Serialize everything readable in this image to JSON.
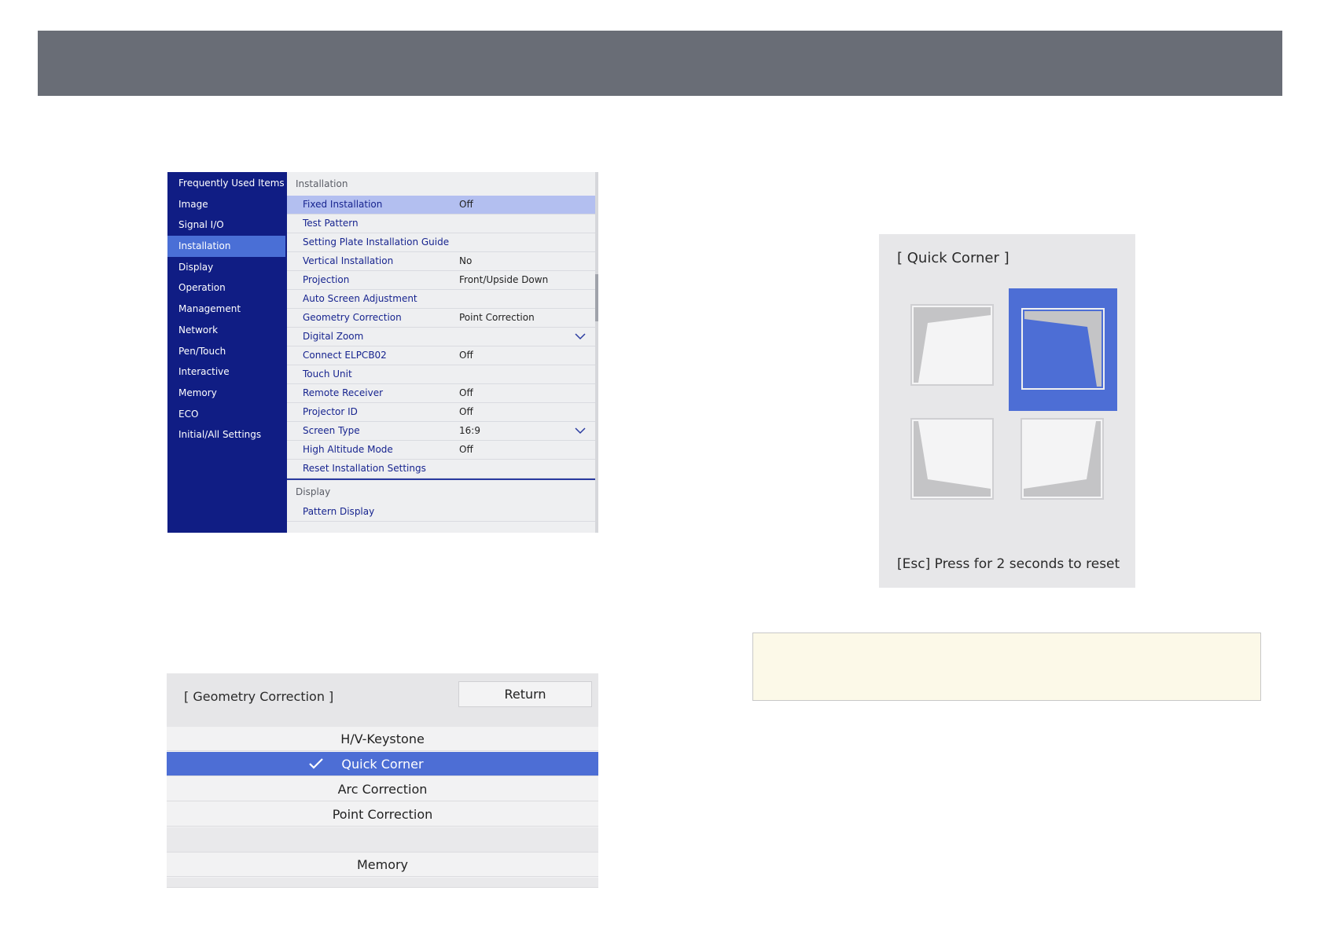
{
  "menu": {
    "sidebar": [
      {
        "label": "Frequently Used Items"
      },
      {
        "label": "Image"
      },
      {
        "label": "Signal I/O"
      },
      {
        "label": "Installation",
        "selected": true
      },
      {
        "label": "Display"
      },
      {
        "label": "Operation"
      },
      {
        "label": "Management"
      },
      {
        "label": "Network"
      },
      {
        "label": "Pen/Touch"
      },
      {
        "label": "Interactive"
      },
      {
        "label": "Memory"
      },
      {
        "label": "ECO"
      },
      {
        "label": "Initial/All Settings"
      }
    ],
    "section_installation": "Installation",
    "rows": [
      {
        "label": "Fixed Installation",
        "value": "Off",
        "highlight": true
      },
      {
        "label": "Test Pattern",
        "value": ""
      },
      {
        "label": "Setting Plate Installation Guide",
        "value": ""
      },
      {
        "label": "Vertical Installation",
        "value": "No"
      },
      {
        "label": "Projection",
        "value": "Front/Upside Down"
      },
      {
        "label": "Auto Screen Adjustment",
        "value": ""
      },
      {
        "label": "Geometry Correction",
        "value": "Point Correction"
      },
      {
        "label": "Digital Zoom",
        "value": "",
        "dropdown": true
      },
      {
        "label": "Connect ELPCB02",
        "value": "Off"
      },
      {
        "label": "Touch Unit",
        "value": ""
      },
      {
        "label": "Remote Receiver",
        "value": "Off"
      },
      {
        "label": "Projector ID",
        "value": "Off"
      },
      {
        "label": "Screen Type",
        "value": "16:9",
        "dropdown": true
      },
      {
        "label": "High Altitude Mode",
        "value": "Off"
      },
      {
        "label": "Reset Installation Settings",
        "value": ""
      }
    ],
    "section_display": "Display",
    "display_rows": [
      {
        "label": "Pattern Display"
      }
    ]
  },
  "geometry": {
    "title": "[ Geometry Correction ]",
    "return_label": "Return",
    "options": [
      {
        "label": "H/V-Keystone"
      },
      {
        "label": "Quick Corner",
        "selected": true
      },
      {
        "label": "Arc Correction"
      },
      {
        "label": "Point Correction"
      }
    ],
    "memory_label": "Memory"
  },
  "quick_corner": {
    "title": "[ Quick Corner ]",
    "selected_corner": "top-right",
    "footer": "[Esc] Press for 2 seconds to reset"
  },
  "colors": {
    "top_bar": "#696d76",
    "sidebar": "#101d84",
    "selection": "#4d6ed5",
    "row_highlight": "#b3bff0",
    "note_background": "#fcf9e8"
  }
}
